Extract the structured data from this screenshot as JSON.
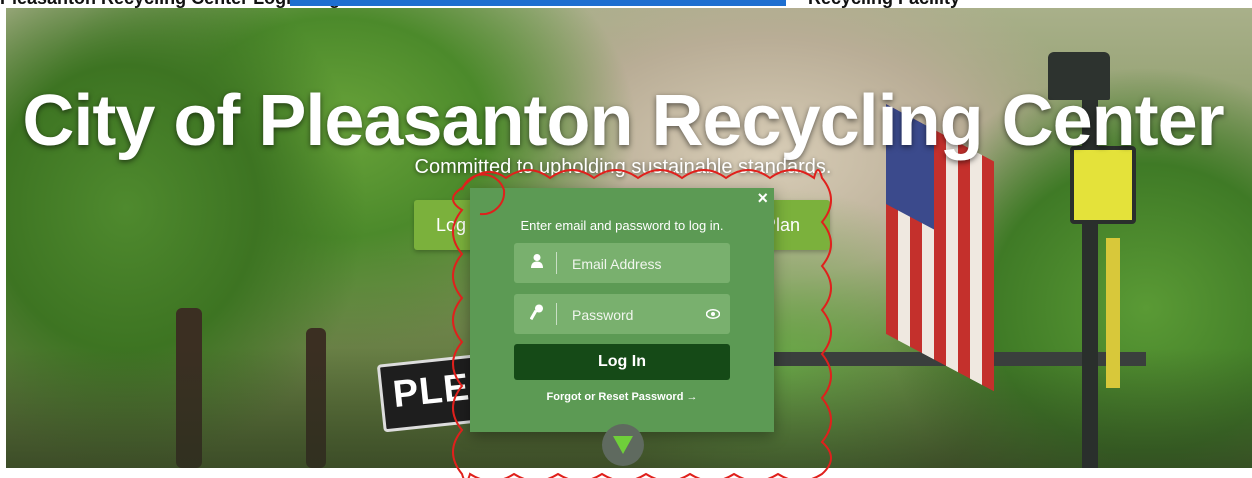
{
  "top_strip": {
    "left_fragment": "Pleasanton Recycling Center Login Page",
    "right_fragment": "Recycling Facility"
  },
  "hero": {
    "title": "City of Pleasanton Recycling Center",
    "tagline": "Committed to upholding sustainable standards.",
    "left_button_label": "Log",
    "right_button_label": "Plan",
    "sign_text": "PLE"
  },
  "login_modal": {
    "close_label": "×",
    "instructions": "Enter email and password to log in.",
    "email_placeholder": "Email Address",
    "password_placeholder": "Password",
    "login_label": "Log In",
    "forgot_label": "Forgot or Reset Password →"
  },
  "colors": {
    "modal_bg": "#5c9a54",
    "field_bg": "#79b06e",
    "login_button": "#154a17",
    "hero_button": "#7bb13c",
    "annotation": "#e0201c"
  },
  "icons": {
    "user": "user-icon",
    "key": "key-icon",
    "eye": "eye-icon",
    "close": "close-icon",
    "down": "triangle-down-icon"
  }
}
